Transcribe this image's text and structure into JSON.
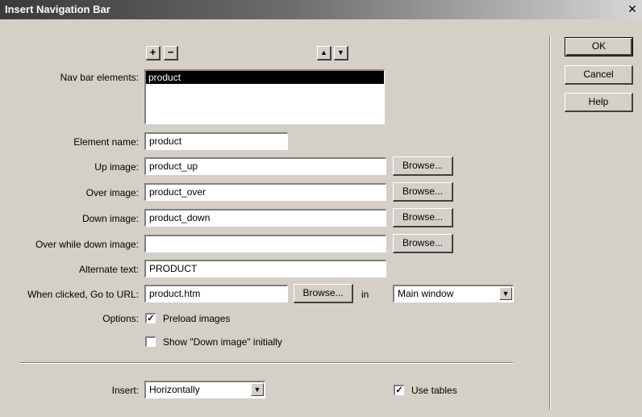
{
  "window": {
    "title": "Insert Navigation Bar",
    "close": "✕"
  },
  "toolbar": {
    "add": "+",
    "remove": "−",
    "move_up": "▲",
    "move_down": "▼"
  },
  "nav_list": {
    "label": "Nav bar elements:",
    "items": [
      "product"
    ]
  },
  "fields": {
    "element_name": {
      "label": "Element name:",
      "value": "product"
    },
    "up_image": {
      "label": "Up image:",
      "value": "product_up"
    },
    "over_image": {
      "label": "Over image:",
      "value": "product_over"
    },
    "down_image": {
      "label": "Down image:",
      "value": "product_down"
    },
    "over_while_down": {
      "label": "Over while down image:",
      "value": ""
    },
    "alternate_text": {
      "label": "Alternate text:",
      "value": "PRODUCT"
    },
    "url": {
      "label": "When clicked, Go to URL:",
      "value": "product.htm",
      "in_label": "in",
      "target": "Main window"
    }
  },
  "browse_label": "Browse...",
  "options": {
    "label": "Options:",
    "preload": {
      "label": "Preload images",
      "checked": true
    },
    "show_down": {
      "label": "Show \"Down image\" initially",
      "checked": false
    }
  },
  "insert": {
    "label": "Insert:",
    "value": "Horizontally"
  },
  "use_tables": {
    "label": "Use tables",
    "checked": true
  },
  "buttons": {
    "ok": "OK",
    "cancel": "Cancel",
    "help": "Help"
  }
}
